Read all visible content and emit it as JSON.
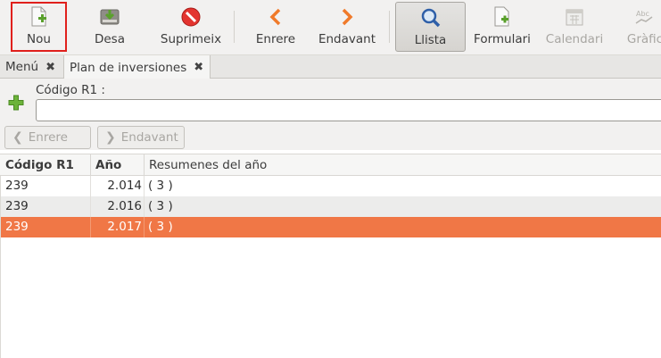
{
  "toolbar": {
    "buttons": [
      {
        "label": "Nou",
        "icon": "new-document-icon"
      },
      {
        "label": "Desa",
        "icon": "save-drive-icon"
      },
      {
        "label": "Suprimeix",
        "icon": "delete-icon"
      },
      {
        "label": "Enrere",
        "icon": "chevron-left-icon"
      },
      {
        "label": "Endavant",
        "icon": "chevron-right-icon"
      },
      {
        "label": "Llista",
        "icon": "magnifier-icon"
      },
      {
        "label": "Formulari",
        "icon": "form-icon"
      },
      {
        "label": "Calendari",
        "icon": "calendar-icon"
      },
      {
        "label": "Gràfic",
        "icon": "graph-icon"
      }
    ]
  },
  "tabs": [
    {
      "label": "Menú"
    },
    {
      "label": "Plan de inversiones"
    }
  ],
  "form": {
    "field_label": "Código R1 :",
    "field_value": "",
    "prev_label": "Enrere",
    "next_label": "Endavant"
  },
  "table": {
    "headers": [
      "Código R1",
      "Año",
      "Resumenes del año"
    ],
    "rows": [
      {
        "codigo": "239",
        "ano": "2.014",
        "resumen": "( 3 )"
      },
      {
        "codigo": "239",
        "ano": "2.016",
        "resumen": "( 3 )"
      },
      {
        "codigo": "239",
        "ano": "2.017",
        "resumen": "( 3 )"
      }
    ],
    "selected_row": 2
  },
  "colors": {
    "selection": "#f07746",
    "highlight_box": "#e0201c",
    "accent_green": "#5aa02c"
  }
}
